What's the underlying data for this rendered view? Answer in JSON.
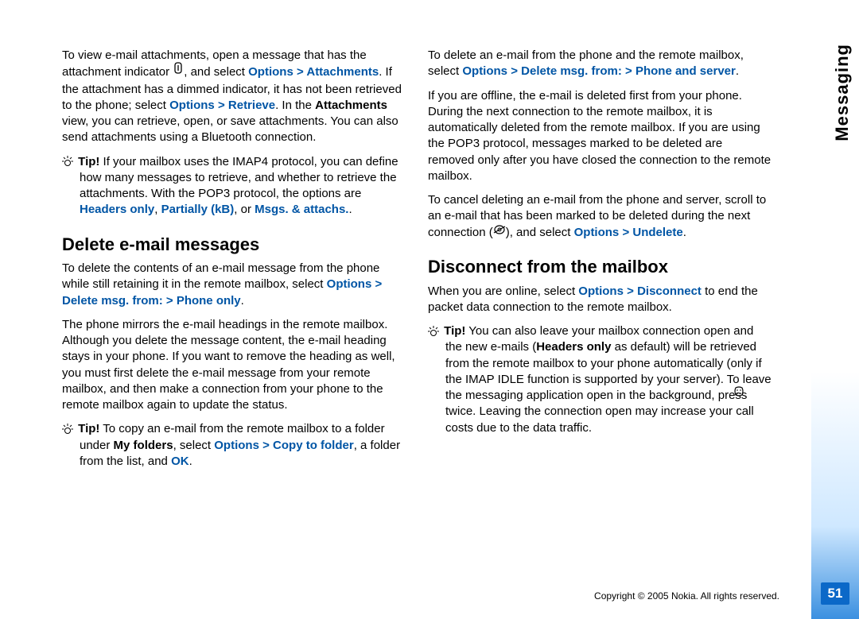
{
  "sidebar": {
    "section": "Messaging",
    "page_num": "51"
  },
  "footer": {
    "copyright": "Copyright © 2005 Nokia. All rights reserved."
  },
  "col1": {
    "p1_a": "To view e-mail attachments, open a message that has the attachment indicator ",
    "p1_b": ", and select ",
    "p1_opt": "Options",
    "p1_gt": " > ",
    "p1_att": "Attachments",
    "p1_c": ". If the attachment has a dimmed indicator, it has not been retrieved to the phone; select ",
    "p1_opt2": "Options",
    "p1_gt2": " > ",
    "p1_ret": "Retrieve",
    "p1_d": ". In the ",
    "p1_attv": "Attachments",
    "p1_e": " view, you can retrieve, open, or save attachments. You can also send attachments using a Bluetooth connection.",
    "tip1_label": "Tip!",
    "tip1_a": " If your mailbox uses the IMAP4 protocol, you can define how many messages to retrieve, and whether to retrieve the attachments. With the POP3 protocol, the options are ",
    "tip1_h": "Headers only",
    "tip1_sep1": ", ",
    "tip1_p": "Partially (kB)",
    "tip1_sep2": ", or ",
    "tip1_m": "Msgs. & attachs.",
    "tip1_end": ".",
    "h2_delete": "Delete e-mail messages",
    "p2_a": "To delete the contents of an e-mail message from the phone while still retaining it in the remote mailbox, select ",
    "p2_opt": "Options",
    "p2_gt": " > ",
    "p2_del": "Delete msg. from:",
    "p2_gt2": " > ",
    "p2_ph": "Phone only",
    "p2_end": ".",
    "p3": "The phone mirrors the e-mail headings in the remote mailbox. Although you delete the message content, the e-mail heading stays in your phone. If you want to remove the heading as well, you must first delete the e-mail message from your remote mailbox, and then make a connection from your phone to the remote mailbox again to update the status.",
    "tip2_label": "Tip!",
    "tip2_a": " To copy an e-mail from the remote mailbox to a folder under ",
    "tip2_mf": "My folders",
    "tip2_b": ", select ",
    "tip2_opt": "Options",
    "tip2_gt": " > ",
    "tip2_cf": "Copy to folder",
    "tip2_c": ", a folder from the list, and ",
    "tip2_ok": "OK",
    "tip2_end": "."
  },
  "col2": {
    "p1_a": "To delete an e-mail from the phone and the remote mailbox, select ",
    "p1_opt": "Options",
    "p1_gt": " > ",
    "p1_del": "Delete msg. from:",
    "p1_gt2": " > ",
    "p1_ps": "Phone and server",
    "p1_end": ".",
    "p2": "If you are offline, the e-mail is deleted first from your phone. During the next connection to the remote mailbox, it is automatically deleted from the remote mailbox. If you are using the POP3 protocol, messages marked to be deleted are removed only after you have closed the connection to the remote mailbox.",
    "p3_a": "To cancel deleting an e-mail from the phone and server, scroll to an e-mail that has been marked to be deleted during the next connection (",
    "p3_b": "), and select ",
    "p3_opt": "Options",
    "p3_gt": " > ",
    "p3_un": "Undelete",
    "p3_end": ".",
    "h2_disc": "Disconnect from the mailbox",
    "p4_a": "When you are online, select ",
    "p4_opt": "Options",
    "p4_gt": " > ",
    "p4_disc": "Disconnect",
    "p4_b": " to end the packet data connection to the remote mailbox.",
    "tip_label": "Tip!",
    "tip_a": " You can also leave your mailbox connection open and the new e-mails (",
    "tip_ho": "Headers only",
    "tip_b": " as default) will be retrieved from the remote mailbox to your phone automatically (only if the IMAP IDLE function is supported by your server). To leave the messaging application open in the background, press ",
    "tip_c": " twice. Leaving the connection open may increase your call costs due to the data traffic."
  }
}
